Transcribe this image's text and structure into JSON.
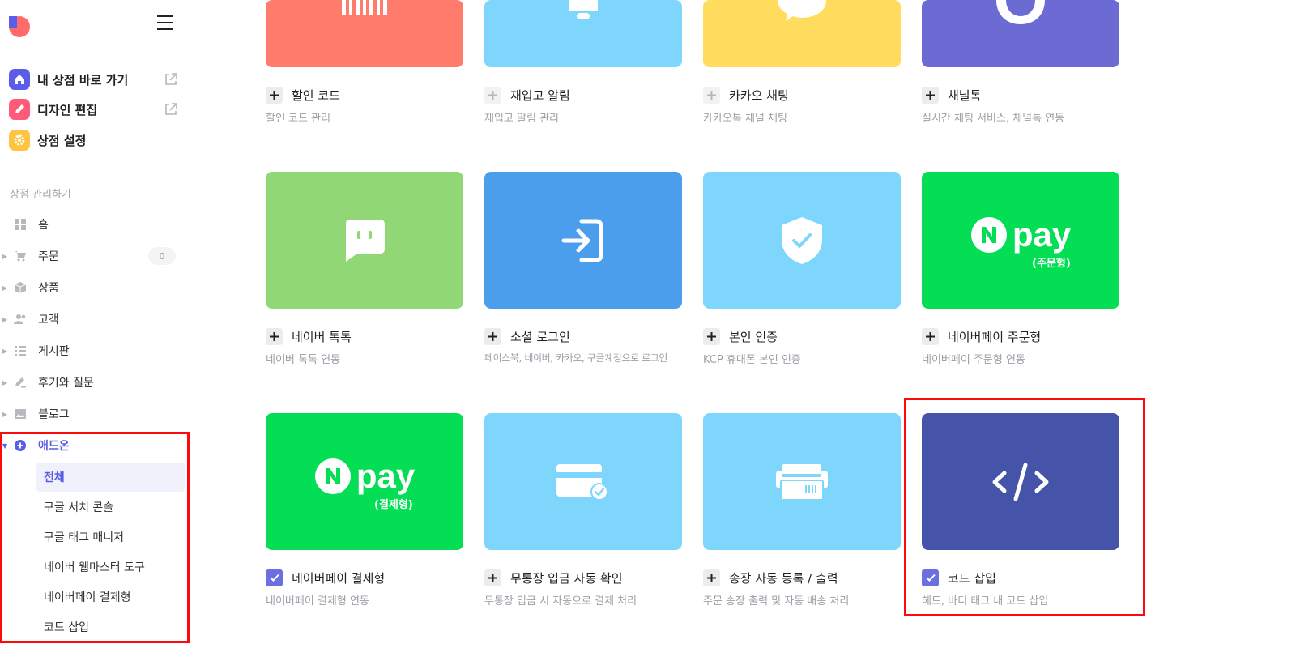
{
  "sidebar": {
    "quick_links": [
      {
        "label": "내 상점 바로 가기",
        "icon": "home-icon",
        "color": "#5a5de8"
      },
      {
        "label": "디자인 편집",
        "icon": "pencil-icon",
        "color": "#ff5a7a"
      },
      {
        "label": "상점 설정",
        "icon": "gear-icon",
        "color": "#ffc542"
      }
    ],
    "section_title": "상점 관리하기",
    "nav": [
      {
        "label": "홈",
        "icon": "dashboard-icon"
      },
      {
        "label": "주문",
        "icon": "cart-icon",
        "badge": "0"
      },
      {
        "label": "상품",
        "icon": "box-icon"
      },
      {
        "label": "고객",
        "icon": "users-icon"
      },
      {
        "label": "게시판",
        "icon": "list-icon"
      },
      {
        "label": "후기와 질문",
        "icon": "edit-icon"
      },
      {
        "label": "블로그",
        "icon": "image-icon"
      },
      {
        "label": "애드온",
        "icon": "plus-circle-icon"
      }
    ],
    "addon_sub": [
      "전체",
      "구글 서치 콘솔",
      "구글 태그 매니저",
      "네이버 웹마스터 도구",
      "네이버페이 결제형",
      "코드 삽입"
    ]
  },
  "cards": [
    {
      "name": "할인 코드",
      "desc": "할인 코드 관리",
      "color": "#ff7b6b",
      "icon": "barcode-icon",
      "state": "plus"
    },
    {
      "name": "재입고 알림",
      "desc": "재입고 알림 관리",
      "color": "#7fd6fc",
      "icon": "bell-icon",
      "state": "plus-light"
    },
    {
      "name": "카카오 채팅",
      "desc": "카카오톡 채널 채팅",
      "color": "#ffdc5e",
      "icon": "kakao-chat-icon",
      "state": "plus-light"
    },
    {
      "name": "채널톡",
      "desc": "실시간 채팅 서비스, 채널톡 연동",
      "color": "#6c6bd3",
      "icon": "channeltalk-icon",
      "state": "plus"
    },
    {
      "name": "네이버 톡톡",
      "desc": "네이버 톡톡 연동",
      "color": "#91d776",
      "icon": "chat-bubble-icon",
      "state": "plus"
    },
    {
      "name": "소셜 로그인",
      "desc": "페이스북, 네이버, 카카오, 구글계정으로 로그인",
      "color": "#4a9eec",
      "icon": "login-icon",
      "state": "plus"
    },
    {
      "name": "본인 인증",
      "desc": "KCP 휴대폰 본인 인증",
      "color": "#7fd6fc",
      "icon": "shield-check-icon",
      "state": "plus"
    },
    {
      "name": "네이버페이 주문형",
      "desc": "네이버페이 주문형 연동",
      "color": "#03de55",
      "icon": "npay-icon",
      "state": "plus",
      "npay_text": "pay",
      "npay_sub": "(주문형)"
    },
    {
      "name": "네이버페이 결제형",
      "desc": "네이버페이 결제형 연동",
      "color": "#03de55",
      "icon": "npay-icon",
      "state": "checked",
      "npay_text": "pay",
      "npay_sub": "(결제형)"
    },
    {
      "name": "무통장 입금 자동 확인",
      "desc": "무통장 입금 시 자동으로 결제 처리",
      "color": "#7fd6fc",
      "icon": "card-check-icon",
      "state": "plus"
    },
    {
      "name": "송장 자동 등록 / 출력",
      "desc": "주문 송장 출력 및 자동 배송 처리",
      "color": "#7fd6fc",
      "icon": "printer-icon",
      "state": "plus"
    },
    {
      "name": "코드 삽입",
      "desc": "헤드, 바디 태그 내 코드 삽입",
      "color": "#4554a8",
      "icon": "code-icon",
      "state": "checked"
    }
  ]
}
